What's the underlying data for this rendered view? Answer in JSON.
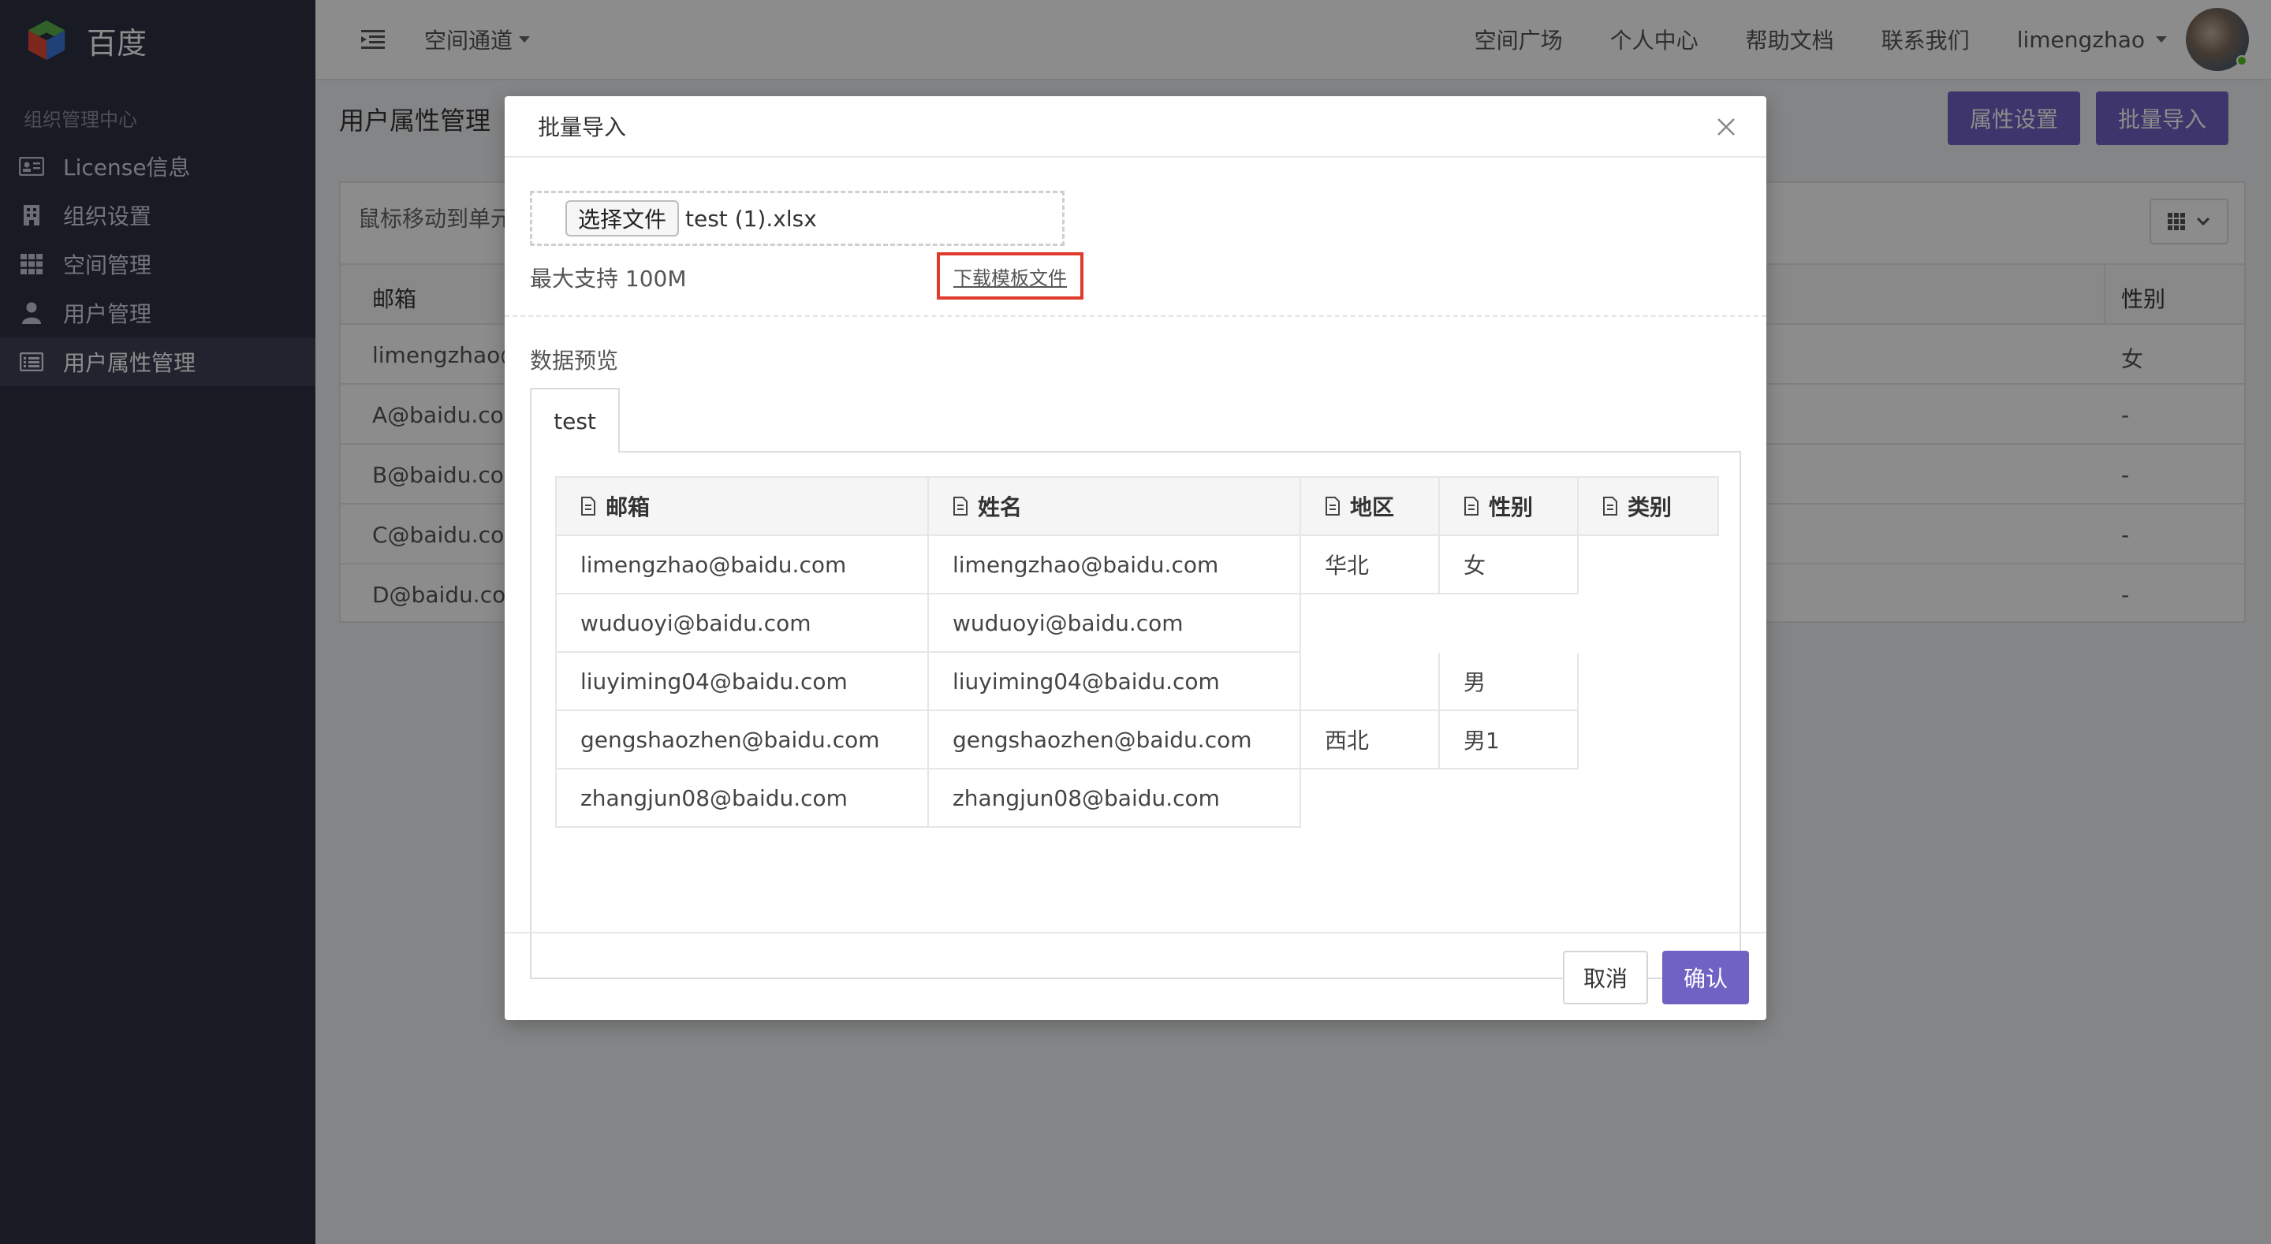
{
  "brand": {
    "name": "百度"
  },
  "sidebar": {
    "section_title": "组织管理中心",
    "items": [
      {
        "label": "License信息",
        "icon": "id-card-icon"
      },
      {
        "label": "组织设置",
        "icon": "building-icon"
      },
      {
        "label": "空间管理",
        "icon": "grid-icon"
      },
      {
        "label": "用户管理",
        "icon": "user-icon"
      },
      {
        "label": "用户属性管理",
        "icon": "list-icon",
        "active": true
      }
    ]
  },
  "header": {
    "channel_label": "空间通道",
    "nav": [
      "空间广场",
      "个人中心",
      "帮助文档",
      "联系我们"
    ],
    "username": "limengzhao"
  },
  "page": {
    "title": "用户属性管理",
    "actions": {
      "attr_settings": "属性设置",
      "batch_import": "批量导入"
    },
    "hint": "鼠标移动到单元",
    "columns": [
      "邮箱",
      "性别"
    ],
    "rows": [
      [
        "limengzhao@",
        "女"
      ],
      [
        "A@baidu.com",
        "-"
      ],
      [
        "B@baidu.com",
        "-"
      ],
      [
        "C@baidu.com",
        "-"
      ],
      [
        "D@baidu.com",
        "-"
      ]
    ]
  },
  "modal": {
    "title": "批量导入",
    "choose_file": "选择文件",
    "file_name": "test (1).xlsx",
    "max_size": "最大支持 100M",
    "download_template": "下载模板文件",
    "preview_label": "数据预览",
    "tab": "test",
    "table": {
      "headers": [
        "邮箱",
        "姓名",
        "地区",
        "性别",
        "类别"
      ],
      "rows": [
        [
          "limengzhao@baidu.com",
          "limengzhao@baidu.com",
          "华北",
          "女",
          ""
        ],
        [
          "wuduoyi@baidu.com",
          "wuduoyi@baidu.com",
          "",
          "",
          ""
        ],
        [
          "liuyiming04@baidu.com",
          "liuyiming04@baidu.com",
          "",
          "男",
          ""
        ],
        [
          "gengshaozhen@baidu.com",
          "gengshaozhen@baidu.com",
          "西北",
          "男1",
          ""
        ],
        [
          "zhangjun08@baidu.com",
          "zhangjun08@baidu.com",
          "",
          "",
          ""
        ]
      ]
    },
    "cancel": "取消",
    "confirm": "确认"
  },
  "colors": {
    "primary": "#6f62c3",
    "sidebar_bg": "#2c3042",
    "highlight": "#e03a2c"
  }
}
